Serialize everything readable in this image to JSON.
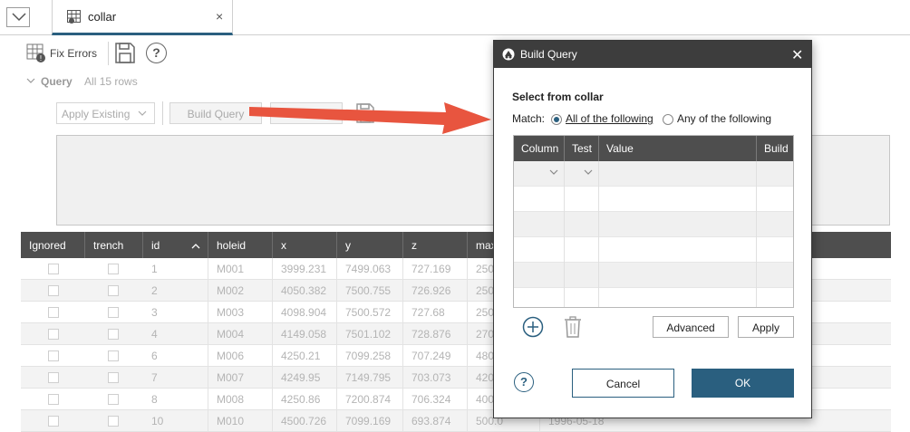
{
  "tab": {
    "title": "collar",
    "close": "×"
  },
  "toolbar": {
    "fix_errors": "Fix Errors",
    "help": "?"
  },
  "query": {
    "label": "Query",
    "rows": "All 15 rows",
    "apply_existing": "Apply Existing",
    "build_query": "Build Query"
  },
  "table": {
    "columns": [
      "Ignored",
      "trench",
      "id",
      "holeid",
      "x",
      "y",
      "z",
      "max"
    ],
    "sort_indicator": "^",
    "rows": [
      {
        "id": "1",
        "holeid": "M001",
        "x": "3999.231",
        "y": "7499.063",
        "z": "727.169",
        "max": "250"
      },
      {
        "id": "2",
        "holeid": "M002",
        "x": "4050.382",
        "y": "7500.755",
        "z": "726.926",
        "max": "250"
      },
      {
        "id": "3",
        "holeid": "M003",
        "x": "4098.904",
        "y": "7500.572",
        "z": "727.68",
        "max": "250"
      },
      {
        "id": "4",
        "holeid": "M004",
        "x": "4149.058",
        "y": "7501.102",
        "z": "728.876",
        "max": "270"
      },
      {
        "id": "6",
        "holeid": "M006",
        "x": "4250.21",
        "y": "7099.258",
        "z": "707.249",
        "max": "480"
      },
      {
        "id": "7",
        "holeid": "M007",
        "x": "4249.95",
        "y": "7149.795",
        "z": "703.073",
        "max": "420"
      },
      {
        "id": "8",
        "holeid": "M008",
        "x": "4250.86",
        "y": "7200.874",
        "z": "706.324",
        "max": "400"
      },
      {
        "id": "10",
        "holeid": "M010",
        "x": "4500.726",
        "y": "7099.169",
        "z": "693.874",
        "max": "500.0",
        "extra": "1996-05-18"
      }
    ]
  },
  "dialog": {
    "title": "Build Query",
    "close": "✕",
    "select_from": "Select from collar",
    "match_label": "Match:",
    "option_all": "All of the following",
    "option_any": "Any of the following",
    "columns": [
      "Column",
      "Test",
      "Value",
      "Build"
    ],
    "advanced": "Advanced",
    "apply": "Apply",
    "help": "?",
    "cancel": "Cancel",
    "ok": "OK"
  },
  "colors": {
    "accent": "#2a5f7f",
    "header_dark": "#4e4e4e",
    "arrow": "#e8553f"
  }
}
